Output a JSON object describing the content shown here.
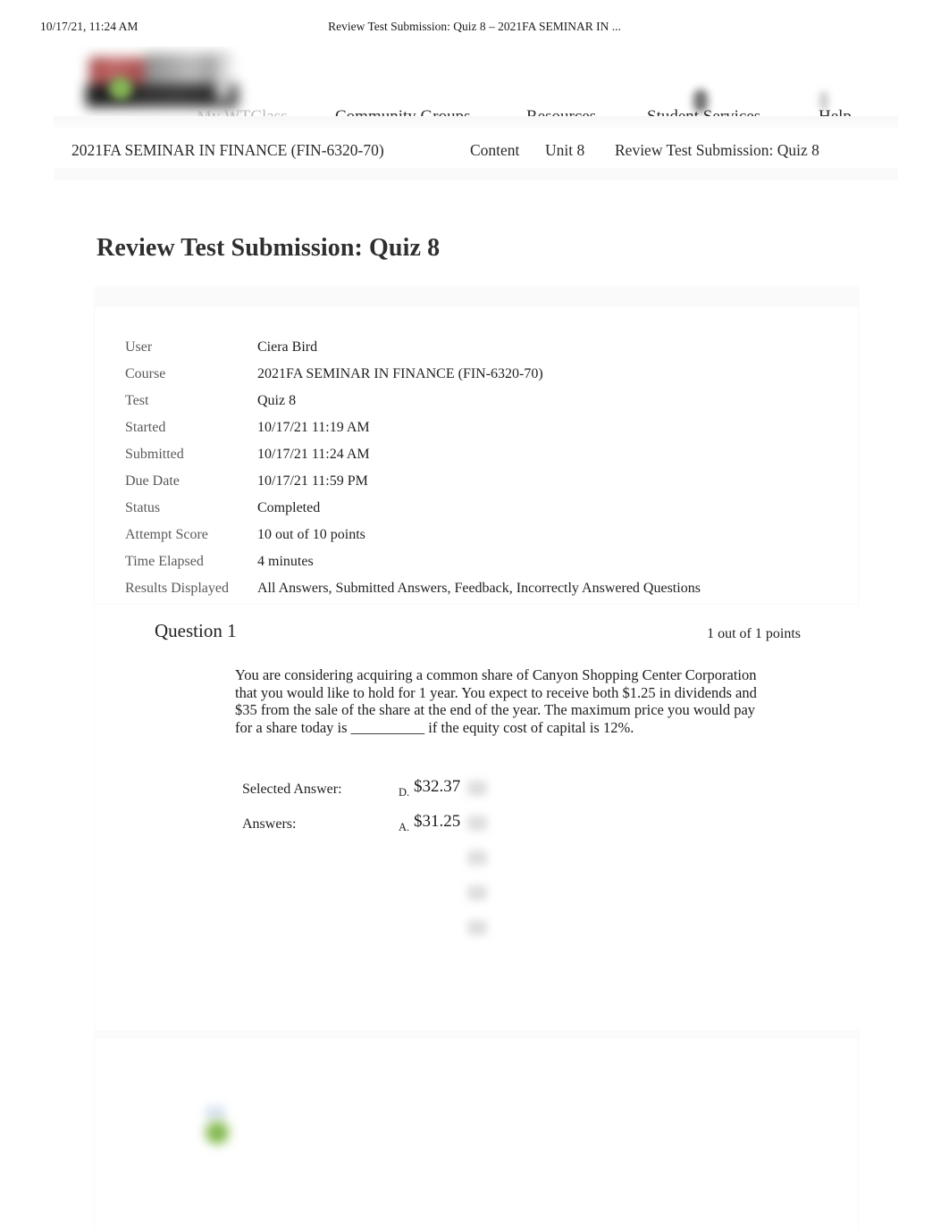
{
  "print_header": {
    "timestamp": "10/17/21, 11:24 AM",
    "document_title": "Review Test Submission: Quiz 8 – 2021FA SEMINAR IN ..."
  },
  "global_nav": {
    "logo_alt": "university-logo",
    "items": [
      {
        "label": "My WTClass",
        "muted": true
      },
      {
        "label": "Community Groups",
        "muted": false
      },
      {
        "label": "Resources",
        "muted": false
      },
      {
        "label": "Student Services",
        "muted": false
      },
      {
        "label": "Help",
        "muted": false
      }
    ]
  },
  "breadcrumb": {
    "course": "2021FA SEMINAR IN FINANCE (FIN-6320-70)",
    "items": [
      "Content",
      "Unit 8",
      "Review Test Submission: Quiz 8"
    ]
  },
  "page": {
    "title": "Review Test Submission: Quiz 8"
  },
  "attempt_info": {
    "rows": [
      {
        "label": "User",
        "value": "Ciera Bird"
      },
      {
        "label": "Course",
        "value": "2021FA SEMINAR IN FINANCE (FIN-6320-70)"
      },
      {
        "label": "Test",
        "value": "Quiz 8"
      },
      {
        "label": "Started",
        "value": "10/17/21 11:19 AM"
      },
      {
        "label": "Submitted",
        "value": "10/17/21 11:24 AM"
      },
      {
        "label": "Due Date",
        "value": "10/17/21 11:59 PM"
      },
      {
        "label": "Status",
        "value": "Completed"
      },
      {
        "label": "Attempt Score",
        "value": "10 out of 10 points"
      },
      {
        "label": "Time Elapsed",
        "value": "4 minutes"
      },
      {
        "label": "Results Displayed",
        "value": "All Answers, Submitted Answers, Feedback, Incorrectly Answered Questions"
      }
    ]
  },
  "question_1": {
    "heading": "Question 1",
    "points": "1 out of 1 points",
    "status_icon": "correct-green-icon",
    "text": "You are considering acquiring a common share of Canyon Shopping Center Corporation that you would like to hold for 1 year. You expect to receive both $1.25 in dividends and $35 from the sale of the share at the end of the year. The maximum price you would pay for a share today is __________ if the equity cost of capital is 12%.",
    "selected_answer_label": "Selected Answer:",
    "selected_answer_letter": "D.",
    "selected_answer_text": "$32.37",
    "answers_label": "Answers:",
    "answers_first_letter": "A.",
    "answers_first_text": "$31.25",
    "redacted_option_count": 5
  },
  "question_2": {
    "status_icon": "correct-green-icon"
  },
  "colors": {
    "page_background": "#ffffff",
    "text_primary": "#1f1f1f",
    "text_label": "#595959",
    "nav_muted": "#b8b8b8",
    "correct_green": "#7bb148",
    "logo_red": "#9e3b3b"
  }
}
